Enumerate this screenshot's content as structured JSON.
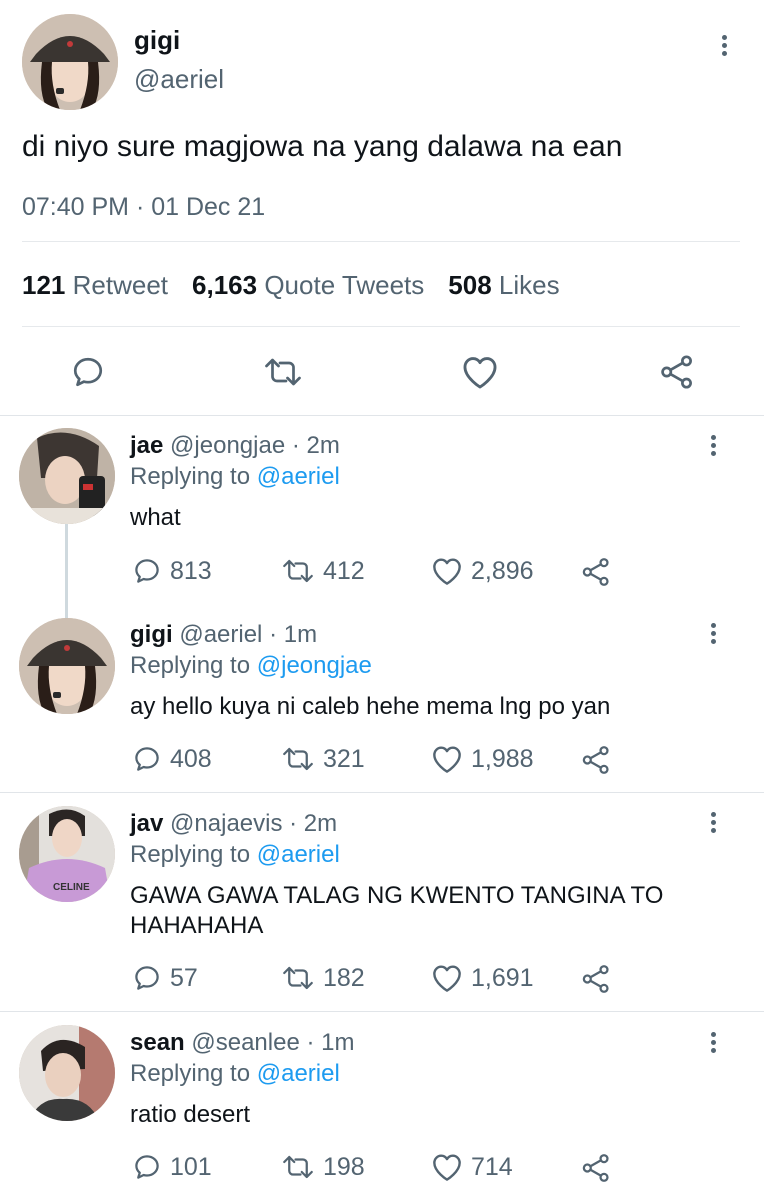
{
  "main_tweet": {
    "display_name": "gigi",
    "handle": "@aeriel",
    "text": "di niyo sure magjowa na yang dalawa na ean",
    "timestamp": "07:40 PM · 01 Dec 21",
    "stats": {
      "retweets_count": "121",
      "retweets_label": "Retweet",
      "quotes_count": "6,163",
      "quotes_label": "Quote Tweets",
      "likes_count": "508",
      "likes_label": "Likes"
    }
  },
  "replying_to_label": "Replying to",
  "replies": [
    {
      "display_name": "jae",
      "handle": "@jeongjae",
      "time": "· 2m",
      "replying_to": "@aeriel",
      "text": "what",
      "replies": "813",
      "retweets": "412",
      "likes": "2,896"
    },
    {
      "display_name": "gigi",
      "handle": "@aeriel",
      "time": "· 1m",
      "replying_to": "@jeongjae",
      "text": "ay hello kuya ni caleb hehe mema lng po yan",
      "replies": "408",
      "retweets": "321",
      "likes": "1,988"
    },
    {
      "display_name": "jav",
      "handle": "@najaevis",
      "time": "· 2m",
      "replying_to": "@aeriel",
      "text": "GAWA GAWA TALAG NG KWENTO TANGINA TO",
      "text_line2": "HAHAHAHA",
      "avatar_shirt_text": "CELINE",
      "replies": "57",
      "retweets": "182",
      "likes": "1,691"
    },
    {
      "display_name": "sean",
      "handle": "@seanlee",
      "time": "· 1m",
      "replying_to": "@aeriel",
      "text": "ratio desert",
      "replies": "101",
      "retweets": "198",
      "likes": "714"
    }
  ],
  "colors": {
    "link": "#1d9bf0",
    "secondary_text": "#536471",
    "divider": "#e1e5e9"
  }
}
